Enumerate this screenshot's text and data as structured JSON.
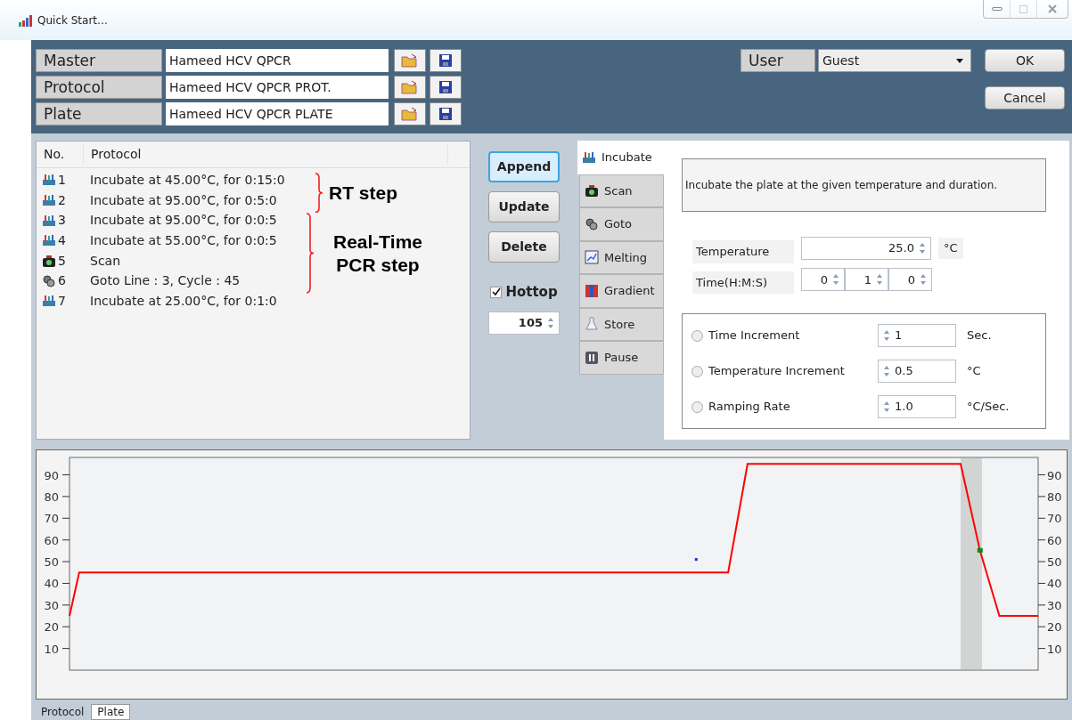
{
  "window": {
    "title": "Quick Start…"
  },
  "files": [
    {
      "label": "Master",
      "value": "Hameed HCV QPCR"
    },
    {
      "label": "Protocol",
      "value": "Hameed HCV QPCR PROT."
    },
    {
      "label": "Plate",
      "value": "Hameed HCV QPCR PLATE"
    }
  ],
  "user": {
    "label": "User",
    "value": "Guest"
  },
  "dialog_buttons": [
    "OK",
    "Cancel"
  ],
  "protocol_list": {
    "columns": [
      "No.",
      "Protocol"
    ],
    "rows": [
      {
        "kind": "incubate",
        "no": "1",
        "text": "Incubate at 45.00°C, for 0:15:0"
      },
      {
        "kind": "incubate",
        "no": "2",
        "text": "Incubate at 95.00°C, for 0:5:0"
      },
      {
        "kind": "incubate",
        "no": "3",
        "text": "Incubate at 95.00°C, for 0:0:5"
      },
      {
        "kind": "incubate",
        "no": "4",
        "text": "Incubate at 55.00°C, for 0:0:5"
      },
      {
        "kind": "scan",
        "no": "5",
        "text": "Scan"
      },
      {
        "kind": "goto",
        "no": "6",
        "text": "Goto Line : 3, Cycle : 45"
      },
      {
        "kind": "incubate",
        "no": "7",
        "text": "Incubate at 25.00°C, for 0:1:0"
      }
    ],
    "annotations": [
      {
        "text": "RT step"
      },
      {
        "text": "Real-Time PCR step"
      }
    ]
  },
  "actions": [
    "Append",
    "Update",
    "Delete"
  ],
  "hottop": {
    "label": "Hottop",
    "checked": true,
    "value": "105"
  },
  "step_tabs": [
    {
      "kind": "incubate",
      "label": "Incubate",
      "selected": true
    },
    {
      "kind": "scan",
      "label": "Scan",
      "selected": false
    },
    {
      "kind": "goto",
      "label": "Goto",
      "selected": false
    },
    {
      "kind": "melting",
      "label": "Melting",
      "selected": false
    },
    {
      "kind": "gradient",
      "label": "Gradient",
      "selected": false
    },
    {
      "kind": "store",
      "label": "Store",
      "selected": false
    },
    {
      "kind": "pause",
      "label": "Pause",
      "selected": false
    }
  ],
  "incubate": {
    "description": "Incubate the plate at the given temperature and duration.",
    "temperature": {
      "label": "Temperature",
      "value": "25.0",
      "unit": "°C"
    },
    "time": {
      "label": "Time(H:M:S)",
      "values": [
        "0",
        "1",
        "0"
      ]
    },
    "options": [
      {
        "label": "Time Increment",
        "selected": false,
        "value": "1",
        "unit": "Sec."
      },
      {
        "label": "Temperature Increment",
        "selected": false,
        "value": "0.5",
        "unit": "°C"
      },
      {
        "label": "Ramping Rate",
        "selected": false,
        "value": "1.0",
        "unit": "°C/Sec."
      }
    ]
  },
  "chart_data": {
    "type": "line",
    "ylim": [
      0,
      98
    ],
    "yticks": [
      10,
      20,
      30,
      40,
      50,
      60,
      70,
      80,
      90
    ],
    "categories": [
      null,
      null,
      null,
      null,
      null,
      null,
      null,
      null,
      null,
      null,
      null,
      null,
      null,
      null,
      null,
      null,
      null,
      null,
      null,
      null,
      null,
      null,
      null,
      null,
      null,
      null,
      null,
      null,
      null,
      null,
      null,
      null,
      null,
      null,
      null,
      null,
      null,
      null,
      null,
      null,
      null,
      null,
      null,
      null,
      null,
      null,
      null,
      null,
      null,
      null,
      null,
      null,
      null,
      null,
      null,
      null,
      null,
      null,
      null,
      null,
      null,
      null,
      null,
      null,
      null,
      null,
      null,
      null,
      null,
      null,
      null,
      null,
      null,
      null,
      null,
      null,
      null,
      null,
      null,
      null,
      null,
      null,
      null,
      null,
      null,
      null,
      null,
      null,
      null,
      null,
      null,
      null,
      null,
      null,
      null,
      null,
      null,
      null,
      null,
      null,
      null
    ],
    "series": [
      {
        "color": "#ff0000",
        "values": [
          25,
          45,
          45,
          45,
          45,
          45,
          45,
          45,
          45,
          45,
          45,
          45,
          45,
          45,
          45,
          45,
          45,
          45,
          45,
          45,
          45,
          45,
          45,
          45,
          45,
          45,
          45,
          45,
          45,
          45,
          45,
          45,
          45,
          45,
          45,
          45,
          45,
          45,
          45,
          45,
          45,
          45,
          45,
          45,
          45,
          45,
          45,
          45,
          45,
          45,
          45,
          45,
          45,
          45,
          45,
          45,
          45,
          45,
          45,
          45,
          45,
          45,
          45,
          45,
          45,
          45,
          45,
          45,
          45,
          70,
          95,
          95,
          95,
          95,
          95,
          95,
          95,
          95,
          95,
          95,
          95,
          95,
          95,
          95,
          95,
          95,
          95,
          95,
          95,
          95,
          95,
          95,
          95,
          75,
          55,
          40,
          25,
          25,
          25,
          25,
          25
        ]
      }
    ]
  },
  "chart_right_axis": {
    "labels": [
      "90",
      "80",
      "70",
      "60",
      "50",
      "40",
      "30",
      "20",
      "10"
    ]
  },
  "bottom_tabs": [
    {
      "label": "Protocol",
      "selected": false
    },
    {
      "label": "Plate",
      "selected": true
    }
  ]
}
